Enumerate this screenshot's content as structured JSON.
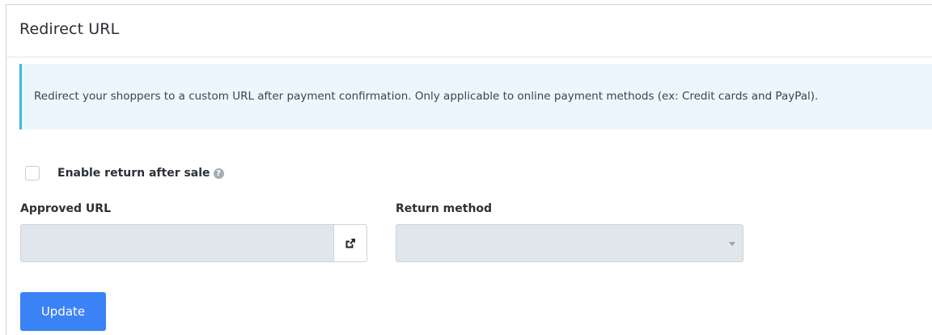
{
  "section": {
    "title": "Redirect URL"
  },
  "info": {
    "message": "Redirect your shoppers to a custom URL after payment confirmation. Only applicable to online payment methods (ex: Credit cards and PayPal)."
  },
  "enable_return": {
    "label": "Enable return after sale",
    "checked": false,
    "help_icon": "question-circle-icon"
  },
  "approved_url": {
    "label": "Approved URL",
    "value": "",
    "open_icon": "external-link-icon"
  },
  "return_method": {
    "label": "Return method",
    "selected": "",
    "dropdown_icon": "caret-down-icon"
  },
  "actions": {
    "update_label": "Update"
  },
  "colors": {
    "primary_button": "#3b82f6",
    "info_bg": "#ebf7fc",
    "info_border": "#3cb8e3",
    "input_bg": "#e1e6ec"
  }
}
